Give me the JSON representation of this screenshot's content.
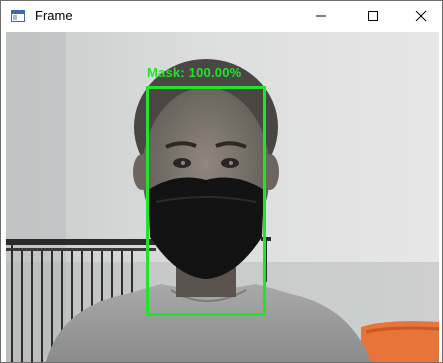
{
  "window": {
    "title": "Frame",
    "icons": {
      "app": "window-app-icon",
      "minimize": "minimize-icon",
      "maximize": "maximize-icon",
      "close": "close-icon"
    }
  },
  "detection": {
    "label": "Mask: 100.00%",
    "color": "#22e32b"
  }
}
